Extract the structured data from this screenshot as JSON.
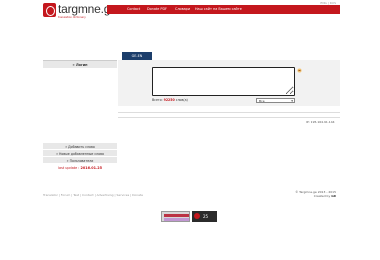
{
  "header": {
    "logo_text": "targmne.ge",
    "logo_tagline": "translation dictionary",
    "top_right_link": "ENG | RUS",
    "nav": [
      {
        "label": "Contact"
      },
      {
        "label": "Donate PDF"
      },
      {
        "label": "Словари"
      },
      {
        "label": "Наш сайт на Вашем сайте"
      }
    ]
  },
  "sidebar": {
    "login_label": "» Логин",
    "menu": [
      {
        "label": "» Добавить слово"
      },
      {
        "label": "» Новые добавленные слова"
      },
      {
        "label": "» Пользователи"
      }
    ],
    "update_label": "last update :",
    "update_date": "2016.01.25"
  },
  "translator": {
    "lang_tab": "GE-EN",
    "input_value": "",
    "count_prefix": "Всего:",
    "count_value": "92250",
    "count_suffix": "слов(а)",
    "dictionary_select": "Все"
  },
  "ip_info": "IP: 195.164.91.144",
  "footer": {
    "links": "Translator | Forum | Test | Contact | Advertising | Services | Donate",
    "copyright": "© Targmne.ge 2013 - 2015",
    "created_by_label": "Created by",
    "created_by_name": "GR",
    "counter_value": "25"
  },
  "colors": {
    "brand_red": "#c4171d",
    "tab_blue": "#1c3e6b",
    "panel_gray": "#f2f2f2"
  }
}
